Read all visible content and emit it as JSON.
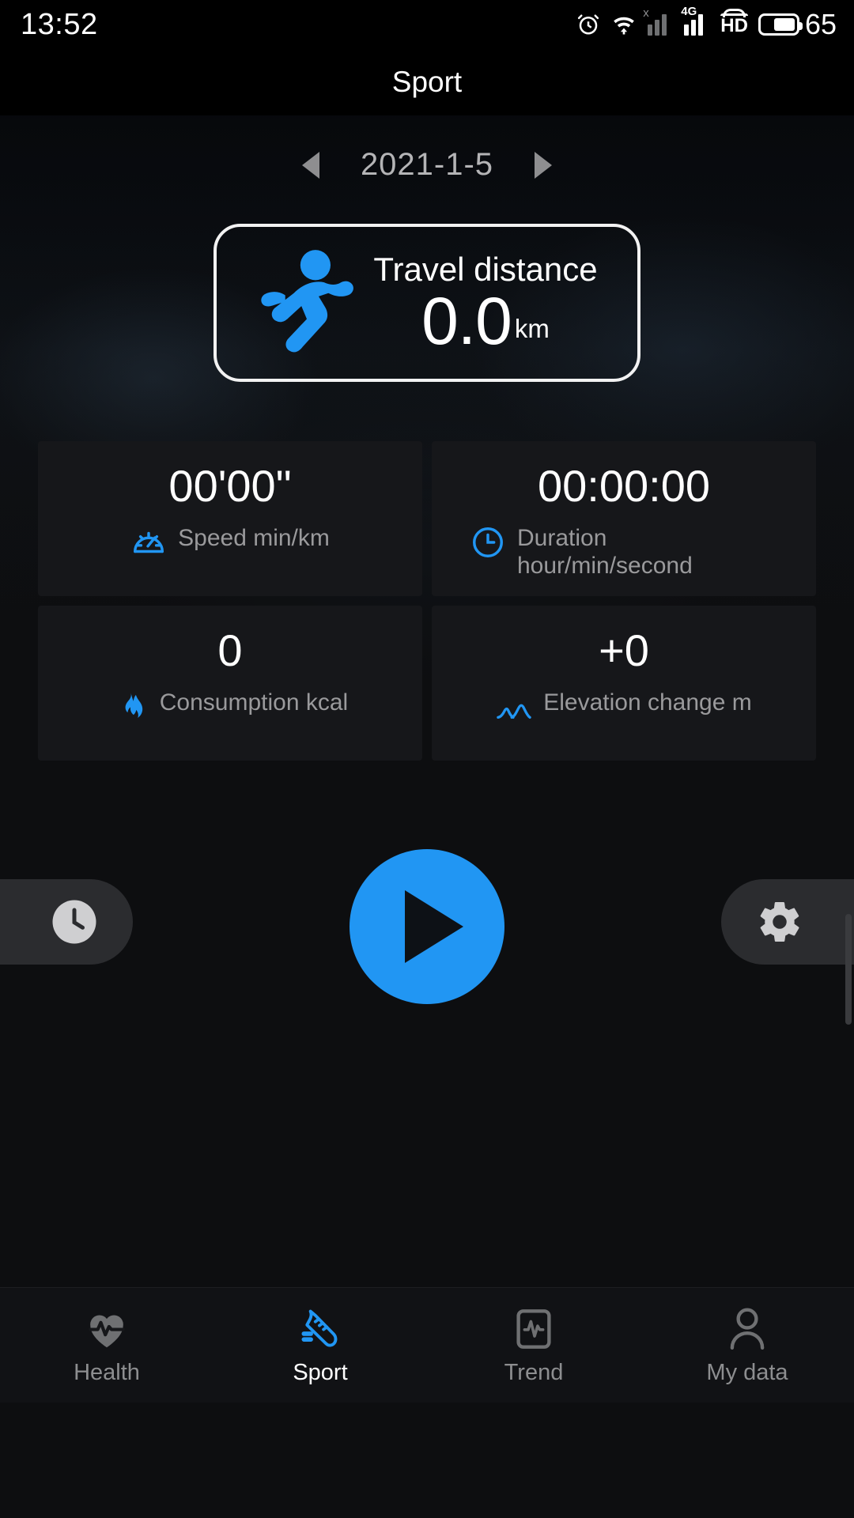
{
  "status_bar": {
    "time": "13:52",
    "battery_level": "65",
    "icons": [
      "alarm-icon",
      "wifi-icon",
      "signal-no-service-icon",
      "signal-4g-icon",
      "volte-hd-icon",
      "battery-icon"
    ],
    "signal_x_label": "x",
    "network_label": "4G",
    "volte_label": "HD"
  },
  "app_bar": {
    "title": "Sport"
  },
  "date_nav": {
    "prev_icon": "chevron-left-icon",
    "date": "2021-1-5",
    "next_icon": "chevron-right-icon"
  },
  "distance_card": {
    "icon": "running-person-icon",
    "title": "Travel distance",
    "value": "0.0",
    "unit": "km"
  },
  "stats": [
    {
      "value": "00'00\"",
      "label": "Speed min/km",
      "icon": "speedometer-icon"
    },
    {
      "value": "00:00:00",
      "label": "Duration hour/min/second",
      "icon": "clock-icon"
    },
    {
      "value": "0",
      "label": "Consumption kcal",
      "icon": "flame-icon"
    },
    {
      "value": "+0",
      "label": "Elevation change m",
      "icon": "mountain-icon"
    }
  ],
  "controls": {
    "history_icon": "clock-history-icon",
    "start_icon": "play-icon",
    "settings_icon": "gear-icon"
  },
  "bottom_nav": {
    "items": [
      {
        "label": "Health",
        "icon": "heart-pulse-icon",
        "active": false
      },
      {
        "label": "Sport",
        "icon": "running-shoe-icon",
        "active": true
      },
      {
        "label": "Trend",
        "icon": "trend-chart-icon",
        "active": false
      },
      {
        "label": "My data",
        "icon": "person-icon",
        "active": false
      }
    ]
  },
  "colors": {
    "accent": "#2196f3",
    "background": "#0d0e10",
    "card": "#16171a",
    "muted_text": "#9a9a9c"
  }
}
